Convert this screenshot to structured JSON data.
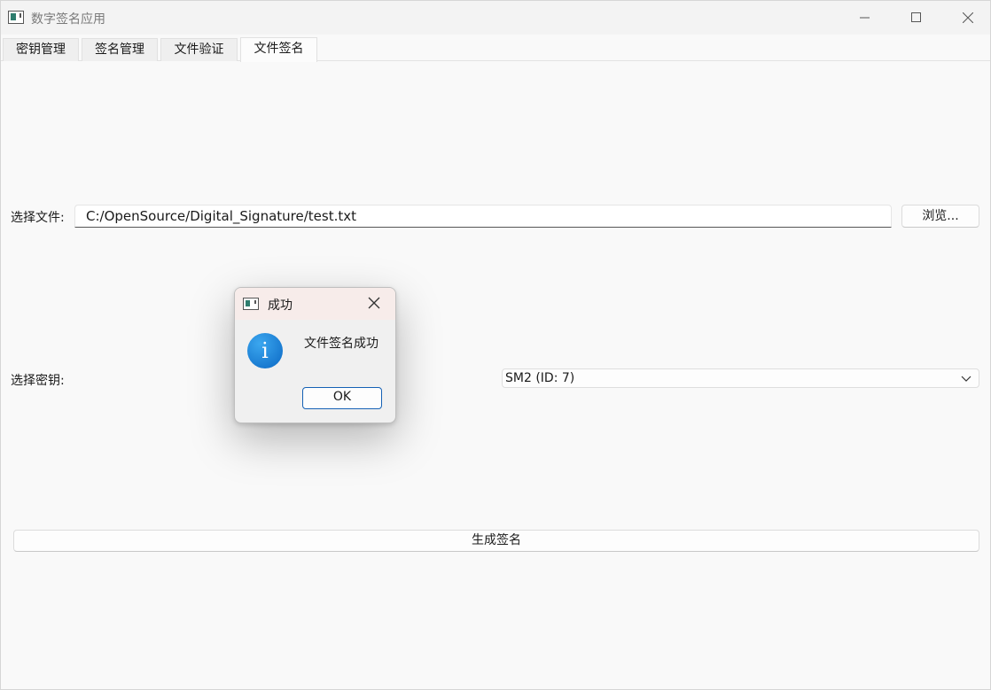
{
  "window": {
    "title": "数字签名应用"
  },
  "tabs": [
    {
      "label": "密钥管理"
    },
    {
      "label": "签名管理"
    },
    {
      "label": "文件验证"
    },
    {
      "label": "文件签名"
    }
  ],
  "file_section": {
    "label": "选择文件:",
    "path_value": "C:/OpenSource/Digital_Signature/test.txt",
    "browse_label": "浏览..."
  },
  "key_section": {
    "label": "选择密钥:",
    "selected_value": "SM2 (ID: 7)"
  },
  "generate_label": "生成签名",
  "dialog": {
    "title": "成功",
    "message": "文件签名成功",
    "ok_label": "OK",
    "icon_glyph": "i"
  }
}
